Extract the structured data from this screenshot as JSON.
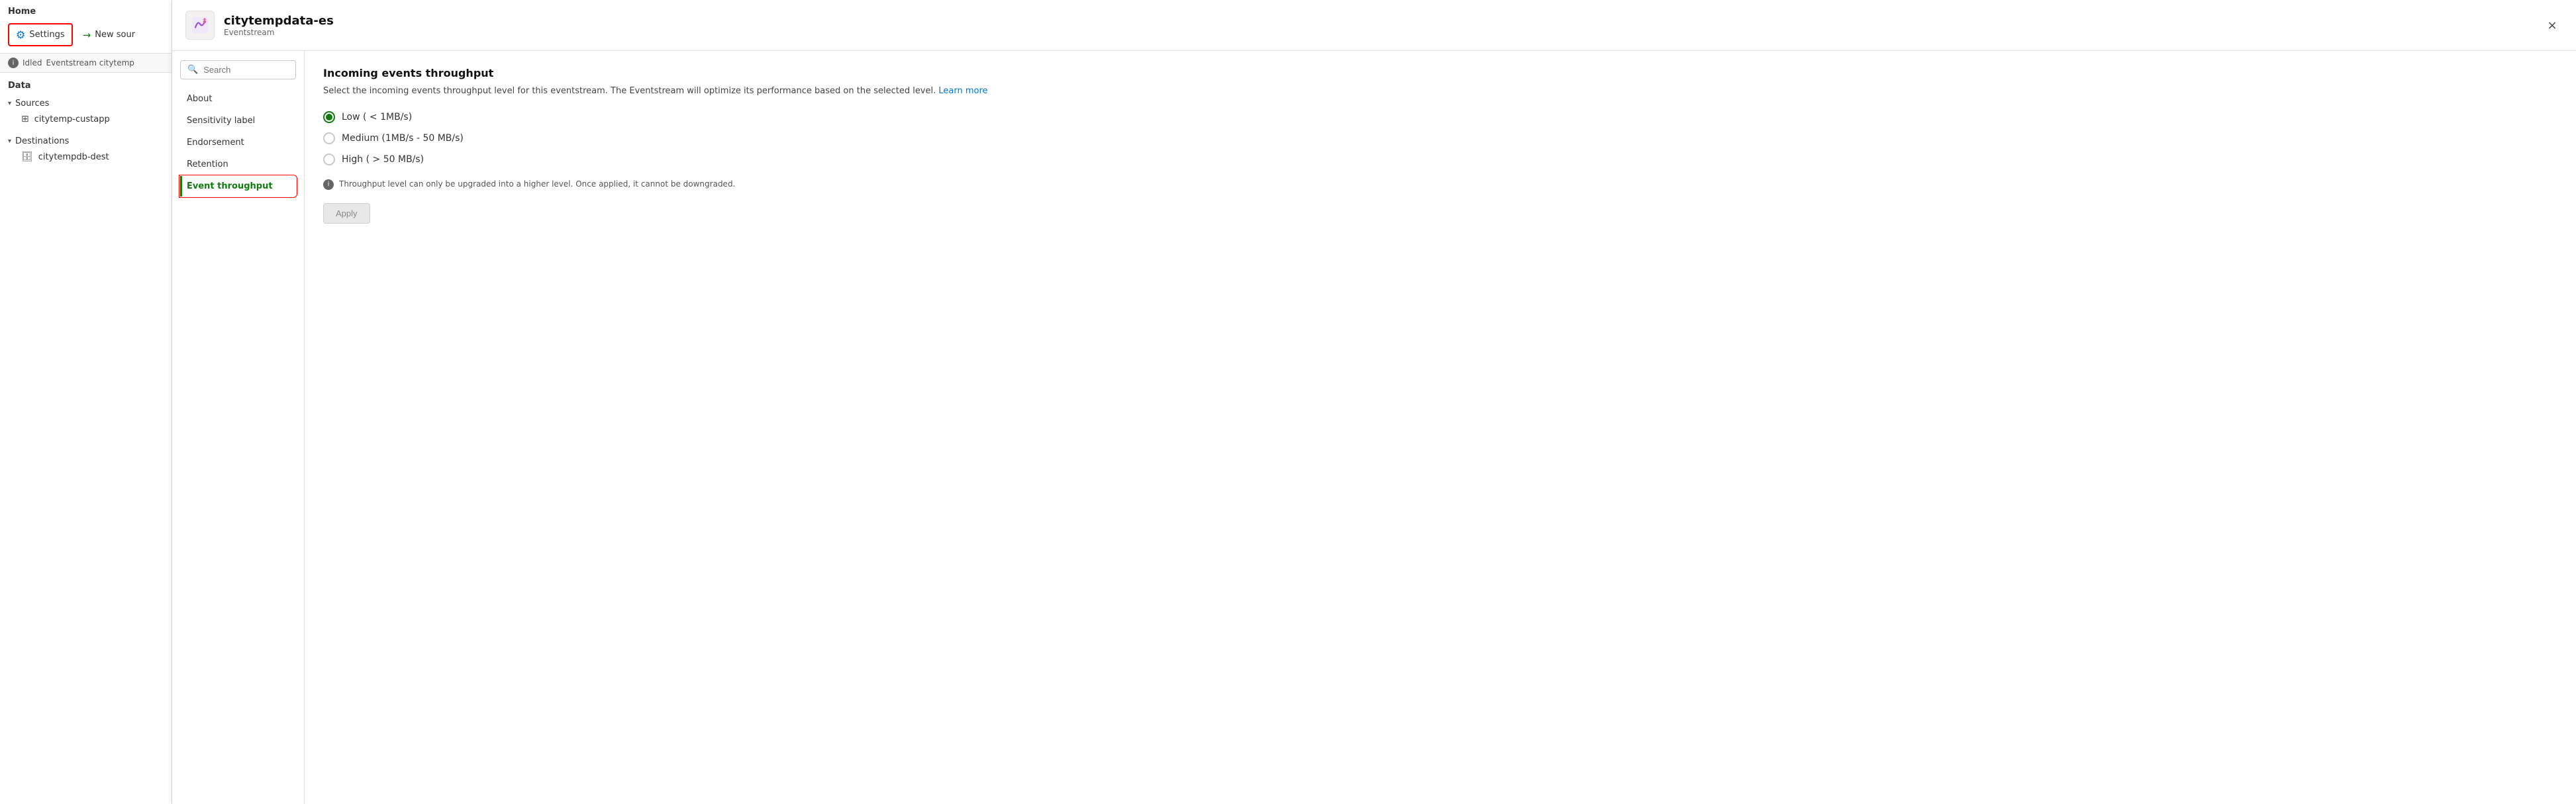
{
  "sidebar": {
    "home_label": "Home",
    "settings_label": "Settings",
    "new_source_label": "New sour",
    "status_text": "Idled",
    "status_detail": "Eventstream citytemp",
    "data_label": "Data",
    "sources_label": "Sources",
    "sources_item": "citytemp-custapp",
    "destinations_label": "Destinations",
    "destinations_item": "citytempdb-dest"
  },
  "panel": {
    "title": "citytempdata-es",
    "subtitle": "Eventstream",
    "close_label": "×",
    "search_placeholder": "Search",
    "nav_items": [
      {
        "id": "about",
        "label": "About",
        "active": false
      },
      {
        "id": "sensitivity",
        "label": "Sensitivity label",
        "active": false
      },
      {
        "id": "endorsement",
        "label": "Endorsement",
        "active": false
      },
      {
        "id": "retention",
        "label": "Retention",
        "active": false
      },
      {
        "id": "event-throughput",
        "label": "Event throughput",
        "active": true
      }
    ],
    "content": {
      "title": "Incoming events throughput",
      "description": "Select the incoming events throughput level for this eventstream. The Eventstream will optimize its performance based on the selected level.",
      "learn_more_label": "Learn more",
      "radio_options": [
        {
          "id": "low",
          "label": "Low ( < 1MB/s)",
          "selected": true
        },
        {
          "id": "medium",
          "label": "Medium (1MB/s - 50 MB/s)",
          "selected": false
        },
        {
          "id": "high",
          "label": "High ( > 50 MB/s)",
          "selected": false
        }
      ],
      "warning_text": "Throughput level can only be upgraded into a higher level. Once applied, it cannot be downgraded.",
      "apply_label": "Apply"
    }
  }
}
